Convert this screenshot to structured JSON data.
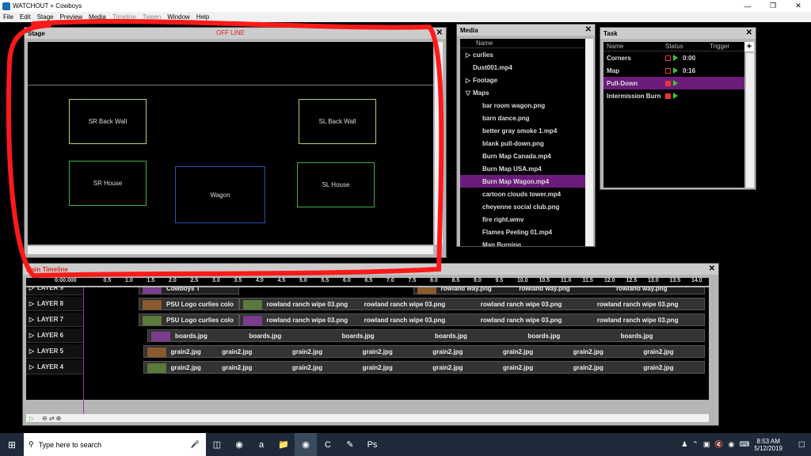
{
  "window": {
    "title": "WATCHOUT + Cowboys"
  },
  "menu": [
    {
      "label": "File",
      "enabled": true
    },
    {
      "label": "Edit",
      "enabled": true
    },
    {
      "label": "Stage",
      "enabled": true
    },
    {
      "label": "Preview",
      "enabled": true
    },
    {
      "label": "Media",
      "enabled": true
    },
    {
      "label": "Timeline",
      "enabled": false
    },
    {
      "label": "Tween",
      "enabled": false
    },
    {
      "label": "Window",
      "enabled": true
    },
    {
      "label": "Help",
      "enabled": true
    }
  ],
  "stage": {
    "title": "Stage",
    "status": "OFF LINE",
    "displays": [
      {
        "label": "SR Back Wall",
        "color": "#c8c86a"
      },
      {
        "label": "SL Back Wall",
        "color": "#c8c86a"
      },
      {
        "label": "SR House",
        "color": "#3cb043"
      },
      {
        "label": "Wagon",
        "color": "#2a4fb5"
      },
      {
        "label": "SL House",
        "color": "#3cb043"
      }
    ]
  },
  "media": {
    "title": "Media",
    "column": "Name",
    "items": [
      {
        "label": "curlies",
        "type": "folder-closed",
        "indent": 0
      },
      {
        "label": "Dust001.mp4",
        "type": "file",
        "indent": 0
      },
      {
        "label": "Footage",
        "type": "folder-closed",
        "indent": 0
      },
      {
        "label": "Maps",
        "type": "folder-open",
        "indent": 0
      },
      {
        "label": "bar room wagon.png",
        "type": "file",
        "indent": 1
      },
      {
        "label": "barn dance.png",
        "type": "file",
        "indent": 1
      },
      {
        "label": "better gray smoke 1.mp4",
        "type": "file",
        "indent": 1
      },
      {
        "label": "blank pull-down.png",
        "type": "file",
        "indent": 1
      },
      {
        "label": "Burn Map Canada.mp4",
        "type": "file",
        "indent": 1
      },
      {
        "label": "Burn Map USA.mp4",
        "type": "file",
        "indent": 1
      },
      {
        "label": "Burn Map Wagon.mp4",
        "type": "file",
        "indent": 1,
        "selected": true
      },
      {
        "label": "cartoon clouds tower.mp4",
        "type": "file",
        "indent": 1
      },
      {
        "label": "cheyenne social club.png",
        "type": "file",
        "indent": 1
      },
      {
        "label": "fire right.wmv",
        "type": "file",
        "indent": 1
      },
      {
        "label": "Flames Peeling 01.mp4",
        "type": "file",
        "indent": 1
      },
      {
        "label": "Map Burning",
        "type": "file",
        "indent": 1
      }
    ]
  },
  "task": {
    "title": "Task",
    "columns": {
      "name": "Name",
      "status": "Status",
      "trigger": "Trigger"
    },
    "add_label": "+",
    "rows": [
      {
        "name": "Corners",
        "time": "0:00",
        "stopped": false,
        "selected": false
      },
      {
        "name": "Map",
        "time": "0:16",
        "stopped": false,
        "selected": false
      },
      {
        "name": "Pull-Down",
        "time": "",
        "stopped": true,
        "selected": true
      },
      {
        "name": "Intermission Burn",
        "time": "",
        "stopped": true,
        "selected": false
      }
    ]
  },
  "timeline": {
    "title": "Main Timeline",
    "time_display": "0:00.000",
    "ticks": [
      "0.5",
      "1.0",
      "1.5",
      "2.0",
      "2.5",
      "3.0",
      "3.5",
      "4.0",
      "4.5",
      "5.0",
      "5.5",
      "6.0",
      "6.5",
      "7.0",
      "7.5",
      "8.0",
      "8.5",
      "9.0",
      "9.5",
      "10.0",
      "10.5",
      "11.0",
      "11.5",
      "12.0",
      "12.5",
      "13.0",
      "13.5",
      "14.0"
    ],
    "layers": [
      {
        "name": "LAYER 9",
        "cues": [
          {
            "label": "Cowboys T",
            "start": 1.2,
            "end": 3.5,
            "dark": true
          },
          {
            "label": "rowland way.png",
            "start": 7.5,
            "end": 14.2,
            "dark": true,
            "repeat": [
              "rowland way.png",
              "rowland way.png"
            ]
          }
        ]
      },
      {
        "name": "LAYER 8",
        "cues": [
          {
            "label": "PSU Logo curlies colo",
            "start": 1.2,
            "end": 3.5
          },
          {
            "label": "rowland ranch wipe 03.png",
            "start": 3.5,
            "end": 14.2,
            "repeat": [
              "rowland ranch wipe 03.png",
              "rowland ranch wipe 03.png",
              "rowland ranch wipe 03.png"
            ]
          }
        ]
      },
      {
        "name": "LAYER 7",
        "cues": [
          {
            "label": "PSU Logo curlies colo",
            "start": 1.2,
            "end": 3.5
          },
          {
            "label": "rowland ranch wipe 03.png",
            "start": 3.5,
            "end": 14.2,
            "repeat": [
              "rowland ranch wipe 03.png",
              "rowland ranch wipe 03.png",
              "rowland ranch wipe 03.png"
            ]
          }
        ]
      },
      {
        "name": "LAYER 6",
        "cues": [
          {
            "label": "boards.jpg",
            "start": 1.4,
            "end": 14.2,
            "repeat": [
              "boards.jpg",
              "boards.jpg",
              "boards.jpg",
              "boards.jpg",
              "boards.jpg"
            ]
          }
        ]
      },
      {
        "name": "LAYER 5",
        "cues": [
          {
            "label": "grain2.jpg",
            "start": 1.3,
            "end": 14.2,
            "repeat": [
              "grain2.jpg",
              "grain2.jpg",
              "grain2.jpg",
              "grain2.jpg",
              "grain2.jpg",
              "grain2.jpg",
              "grain2.jpg"
            ]
          }
        ]
      },
      {
        "name": "LAYER 4",
        "cues": [
          {
            "label": "grain2.jpg",
            "start": 1.3,
            "end": 14.2,
            "repeat": [
              "grain2.jpg",
              "grain2.jpg",
              "grain2.jpg",
              "grain2.jpg",
              "grain2.jpg",
              "grain2.jpg",
              "grain2.jpg"
            ]
          }
        ]
      }
    ]
  },
  "taskbar": {
    "search_placeholder": "Type here to search",
    "apps": [
      "task-view-icon",
      "chrome-icon",
      "amazon-icon",
      "file-explorer-icon",
      "watchout-icon",
      "camtasia-icon",
      "notes-icon",
      "photoshop-icon"
    ],
    "clock_time": "8:53 AM",
    "clock_date": "5/12/2019"
  },
  "colors": {
    "selection": "#6b1c7a",
    "annotation": "#ff1a1a",
    "offline": "#dd2222"
  }
}
